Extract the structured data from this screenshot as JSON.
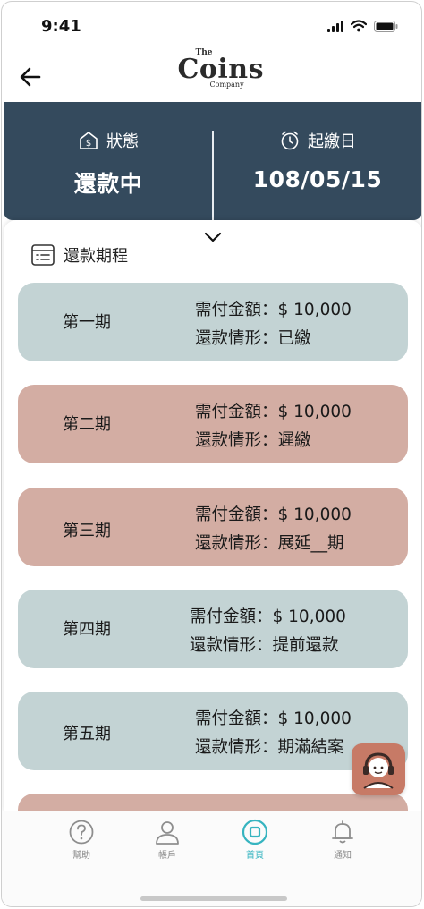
{
  "status_bar": {
    "time": "9:41"
  },
  "header": {
    "logo_the": "The",
    "logo_main": "Coins",
    "logo_sub": "Company"
  },
  "info": {
    "status_label": "狀態",
    "status_value": "還款中",
    "date_label": "起繳日",
    "date_value": "108/05/15"
  },
  "schedule": {
    "title": "還款期程",
    "items": [
      {
        "period": "第一期",
        "amount": "需付金額：$ 10,000",
        "state": "還款情形：已繳",
        "tone": "paid"
      },
      {
        "period": "第二期",
        "amount": "需付金額：$ 10,000",
        "state": "還款情形：遲繳",
        "tone": "late"
      },
      {
        "period": "第三期",
        "amount": "需付金額：$ 10,000",
        "state": "還款情形：展延__期",
        "tone": "late"
      },
      {
        "period": "第四期",
        "amount": "需付金額：$ 10,000",
        "state": "還款情形：提前還款",
        "tone": "paid"
      },
      {
        "period": "第五期",
        "amount": "需付金額：$ 10,000",
        "state": "還款情形：期滿結案",
        "tone": "paid"
      }
    ]
  },
  "tabs": [
    {
      "label": "幫助",
      "icon": "help-icon"
    },
    {
      "label": "帳戶",
      "icon": "user-icon"
    },
    {
      "label": "首頁",
      "icon": "home-icon",
      "active": true
    },
    {
      "label": "通知",
      "icon": "bell-icon"
    }
  ],
  "colors": {
    "panel": "#344a5d",
    "card_paid": "#c3d3d4",
    "card_late": "#d3ada3",
    "accent": "#36b4c0",
    "support": "#c77a66"
  }
}
